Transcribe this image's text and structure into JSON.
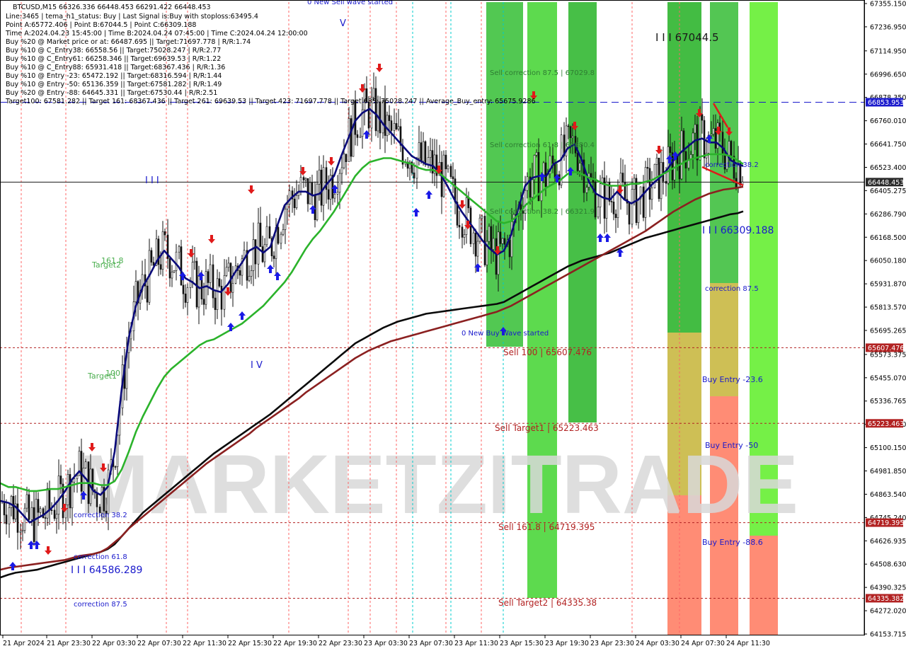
{
  "chart_data": {
    "type": "line",
    "symbol": "BTCUSD,M15",
    "header": "BTCUSD,M15  66326.336 66448.453 66291.422 66448.453",
    "info_lines": [
      "Line:3465 | tema_h1_status: Buy | Last Signal is:Buy with stoploss:63495.4",
      "Point A:65772.406 | Point B:67044.5 | Point C:66309.188",
      "Time A:2024.04.23 15:45:00 | Time B:2024.04.24 07:45:00 | Time C:2024.04.24 12:00:00",
      "Buy %20 @ Market price or at: 66487.695 || Target:71697.778 | R/R:1.74",
      "Buy %10 @ C_Entry38: 66558.56 || Target:75028.247 | R/R:2.77",
      "Buy %10 @ C_Entry61: 66258.346 || Target:69639.53 | R/R:1.22",
      "Buy %10 @ C_Entry88: 65931.418 || Target:68367.436 | R/R:1.36",
      "Buy %10 @ Entry -23: 65472.192 || Target:68316.594 | R/R:1.44",
      "Buy %10 @ Entry -50: 65136.359 || Target:67581.282 | R/R:1.49",
      "Buy %20 @ Entry -88: 64645.331 || Target:67530.44 | R/R:2.51",
      "Target100: 67581.282 || Target 161: 68367.436 || Target 261: 69639.53 || Target 423: 71697.778 || Target 685: 75028.247 || Average_Buy_entry: 65675.9286"
    ],
    "watermark": "MARKETZITRADE",
    "ylim": [
      64153.715,
      67355.15
    ],
    "y_ticks": [
      "67355.150",
      "67236.950",
      "67114.950",
      "66996.650",
      "66878.350",
      "66760.010",
      "66641.750",
      "66523.400",
      "66405.275",
      "66286.790",
      "66168.500",
      "66050.180",
      "65931.870",
      "65813.570",
      "65695.265",
      "65573.375",
      "65455.070",
      "65336.765",
      "65218.460",
      "65100.150",
      "64981.850",
      "64863.540",
      "64745.240",
      "64626.935",
      "64508.630",
      "64390.325",
      "64272.020",
      "64153.715"
    ],
    "x_ticks": [
      "21 Apr 2024",
      "21 Apr 23:30",
      "22 Apr 03:30",
      "22 Apr 07:30",
      "22 Apr 11:30",
      "22 Apr 15:30",
      "22 Apr 19:30",
      "22 Apr 23:30",
      "23 Apr 03:30",
      "23 Apr 07:30",
      "23 Apr 11:30",
      "23 Apr 15:30",
      "23 Apr 19:30",
      "23 Apr 23:30",
      "24 Apr 03:30",
      "24 Apr 07:30",
      "24 Apr 11:30"
    ],
    "price_markers": [
      {
        "value": 66853.953,
        "label": "66853.953",
        "color": "#1a1acc",
        "style": "dashed"
      },
      {
        "value": 66448.453,
        "label": "66448.453",
        "color": "#1a1a1a",
        "style": "solid"
      },
      {
        "value": 65607.476,
        "label": "65607.476",
        "color": "#b22222",
        "style": "dotted"
      },
      {
        "value": 65223.463,
        "label": "65223.463",
        "color": "#b22222",
        "style": "dotted"
      },
      {
        "value": 64719.395,
        "label": "64719.395",
        "color": "#b22222",
        "style": "dotted"
      },
      {
        "value": 64335.382,
        "label": "64335.382",
        "color": "#b22222",
        "style": "dotted"
      }
    ],
    "annotations": [
      {
        "text": "0 New Sell wave started",
        "color": "#1a1acc"
      },
      {
        "text": "Sell correction 87.5 | 67029.8",
        "color": "#2e7d32"
      },
      {
        "text": "Sell correction 61.8 | 66680.4",
        "color": "#2e7d32"
      },
      {
        "text": "Sell correction 38.2 | 66321.9",
        "color": "#2e7d32"
      },
      {
        "text": "0 New Buy Wave started",
        "color": "#1a1acc"
      },
      {
        "text": "Sell 100 | 65607.476",
        "color": "#b22222"
      },
      {
        "text": "Sell Target1 | 65223.463",
        "color": "#b22222"
      },
      {
        "text": "Sell 161.8 | 64719.395",
        "color": "#b22222"
      },
      {
        "text": "Sell Target2 | 64335.38",
        "color": "#b22222"
      },
      {
        "text": "I I I 67044.5",
        "color": "#1a1a1a"
      },
      {
        "text": "correction 38.2",
        "color": "#1a1acc"
      },
      {
        "text": "I I I 66309.188",
        "color": "#1a1acc"
      },
      {
        "text": "correction 87.5",
        "color": "#1a1acc"
      },
      {
        "text": "Buy Entry -23.6",
        "color": "#1a1acc"
      },
      {
        "text": "Buy Entry -50",
        "color": "#1a1acc"
      },
      {
        "text": "Buy Entry -88.6",
        "color": "#1a1acc"
      },
      {
        "text": "Target2",
        "color": "#4caf50"
      },
      {
        "text": "161.8",
        "color": "#4caf50"
      },
      {
        "text": "Target1",
        "color": "#4caf50"
      },
      {
        "text": "100",
        "color": "#4caf50"
      },
      {
        "text": "correction 38.2",
        "color": "#1a1acc"
      },
      {
        "text": "correction 61.8",
        "color": "#1a1acc"
      },
      {
        "text": "I I I 64586.289",
        "color": "#1a1acc"
      },
      {
        "text": "correction 87.5",
        "color": "#1a1acc"
      },
      {
        "text": "I I I",
        "color": "#1a1acc"
      },
      {
        "text": "I V",
        "color": "#1a1acc"
      },
      {
        "text": "V",
        "color": "#1a1acc"
      }
    ],
    "series": [
      {
        "name": "",
        "color": "#0a0a7a",
        "x": [
          0,
          12,
          22,
          32,
          42,
          52,
          62,
          72,
          82,
          92,
          102,
          112,
          122,
          132,
          142,
          152,
          162,
          172,
          182,
          192,
          202,
          212,
          222,
          232,
          242,
          252,
          262,
          272,
          282,
          292,
          302,
          312,
          322,
          332,
          342,
          352,
          362,
          372,
          382,
          392,
          402,
          412,
          422,
          432,
          442,
          452,
          462,
          472,
          482,
          492,
          502,
          512,
          522,
          532,
          542,
          552,
          562,
          572,
          582,
          592,
          602,
          612,
          622,
          632,
          642,
          652,
          662,
          672,
          682,
          692,
          702,
          712,
          722,
          732,
          742,
          752,
          762,
          772,
          782,
          792,
          802,
          812,
          822,
          832,
          842,
          852,
          862,
          872,
          882,
          892,
          902,
          912,
          922,
          932,
          942,
          952,
          962,
          972,
          982,
          992,
          1002,
          1012,
          1022,
          1032,
          1042,
          1050
        ],
        "values": [
          64830,
          64820,
          64800,
          64760,
          64720,
          64740,
          64760,
          64790,
          64830,
          64880,
          64940,
          64980,
          64940,
          64880,
          64860,
          64900,
          65080,
          65400,
          65660,
          65820,
          65920,
          65980,
          66050,
          66100,
          66060,
          66020,
          65960,
          65940,
          65910,
          65920,
          65900,
          65890,
          65930,
          65990,
          66040,
          66100,
          66120,
          66090,
          66120,
          66230,
          66330,
          66370,
          66400,
          66400,
          66380,
          66390,
          66440,
          66480,
          66580,
          66670,
          66760,
          66800,
          66820,
          66790,
          66740,
          66700,
          66660,
          66620,
          66580,
          66560,
          66540,
          66530,
          66490,
          66430,
          66360,
          66300,
          66250,
          66200,
          66150,
          66110,
          66080,
          66100,
          66180,
          66310,
          66430,
          66470,
          66480,
          66480,
          66540,
          66560,
          66620,
          66640,
          66560,
          66450,
          66390,
          66370,
          66360,
          66400,
          66360,
          66340,
          66360,
          66400,
          66440,
          66470,
          66510,
          66560,
          66600,
          66630,
          66660,
          66670,
          66650,
          66650,
          66620,
          66560,
          66540,
          66530
        ]
      },
      {
        "name": "",
        "color": "#2bb32b",
        "x": [
          0,
          12,
          22,
          32,
          42,
          52,
          62,
          72,
          82,
          92,
          102,
          112,
          122,
          132,
          142,
          152,
          162,
          172,
          182,
          192,
          202,
          212,
          222,
          232,
          242,
          252,
          262,
          272,
          282,
          292,
          302,
          312,
          322,
          332,
          342,
          352,
          362,
          372,
          382,
          392,
          402,
          412,
          422,
          432,
          442,
          452,
          462,
          472,
          482,
          492,
          502,
          512,
          522,
          532,
          542,
          552,
          562,
          572,
          582,
          592,
          602,
          612,
          622,
          632,
          642,
          652,
          662,
          672,
          682,
          692,
          702,
          712,
          722,
          732,
          742,
          752,
          762,
          772,
          782,
          792,
          802,
          812,
          822,
          832,
          842,
          852,
          862,
          872,
          882,
          892,
          902,
          912,
          922,
          932,
          942,
          952,
          962,
          972,
          982,
          992,
          1002,
          1012,
          1022,
          1032,
          1042,
          1050
        ],
        "values": [
          64920,
          64900,
          64900,
          64890,
          64880,
          64880,
          64885,
          64890,
          64890,
          64900,
          64910,
          64920,
          64920,
          64920,
          64910,
          64910,
          64930,
          64990,
          65080,
          65180,
          65260,
          65330,
          65400,
          65460,
          65500,
          65530,
          65560,
          65590,
          65620,
          65640,
          65650,
          65670,
          65690,
          65710,
          65730,
          65760,
          65790,
          65820,
          65860,
          65900,
          65940,
          65990,
          66050,
          66110,
          66160,
          66200,
          66250,
          66300,
          66360,
          66420,
          66480,
          66520,
          66550,
          66560,
          66570,
          66570,
          66560,
          66550,
          66540,
          66520,
          66510,
          66510,
          66490,
          66460,
          66430,
          66400,
          66370,
          66340,
          66310,
          66280,
          66250,
          66240,
          66250,
          66280,
          66330,
          66360,
          66390,
          66420,
          66440,
          66460,
          66490,
          66500,
          66490,
          66470,
          66460,
          66440,
          66430,
          66430,
          66430,
          66440,
          66440,
          66450,
          66460,
          66480,
          66500,
          66520,
          66540,
          66560,
          66570,
          66580,
          66590,
          66590,
          66590,
          66580,
          66560,
          66540
        ]
      },
      {
        "name": "",
        "color": "#0a0a0a",
        "x": [
          0,
          12,
          22,
          32,
          42,
          52,
          62,
          72,
          82,
          92,
          102,
          112,
          122,
          132,
          142,
          152,
          162,
          172,
          182,
          192,
          202,
          212,
          222,
          232,
          242,
          252,
          262,
          272,
          282,
          292,
          302,
          312,
          322,
          332,
          342,
          352,
          362,
          372,
          382,
          392,
          402,
          412,
          422,
          432,
          442,
          452,
          462,
          472,
          482,
          492,
          502,
          512,
          522,
          532,
          542,
          552,
          562,
          572,
          582,
          592,
          602,
          612,
          622,
          632,
          642,
          652,
          662,
          672,
          682,
          692,
          702,
          712,
          722,
          732,
          742,
          752,
          762,
          772,
          782,
          792,
          802,
          812,
          822,
          832,
          842,
          852,
          862,
          872,
          882,
          892,
          902,
          912,
          922,
          932,
          942,
          952,
          962,
          972,
          982,
          992,
          1002,
          1012,
          1022,
          1032,
          1042,
          1050
        ],
        "values": [
          64440,
          64455,
          64465,
          64470,
          64475,
          64480,
          64490,
          64500,
          64510,
          64520,
          64530,
          64540,
          64550,
          64560,
          64570,
          64585,
          64610,
          64650,
          64690,
          64730,
          64770,
          64800,
          64830,
          64860,
          64890,
          64920,
          64950,
          64980,
          65010,
          65040,
          65070,
          65095,
          65120,
          65145,
          65170,
          65195,
          65220,
          65245,
          65270,
          65300,
          65330,
          65360,
          65390,
          65420,
          65450,
          65480,
          65510,
          65540,
          65570,
          65600,
          65630,
          65650,
          65670,
          65690,
          65710,
          65725,
          65740,
          65750,
          65760,
          65770,
          65780,
          65785,
          65790,
          65795,
          65800,
          65805,
          65810,
          65815,
          65820,
          65825,
          65830,
          65840,
          65860,
          65880,
          65900,
          65920,
          65940,
          65960,
          65980,
          66000,
          66020,
          66035,
          66050,
          66060,
          66070,
          66080,
          66090,
          66105,
          66120,
          66135,
          66150,
          66165,
          66175,
          66185,
          66195,
          66205,
          66215,
          66225,
          66235,
          66245,
          66255,
          66265,
          66275,
          66285,
          66290,
          66300
        ]
      },
      {
        "name": "",
        "color": "#8b2020",
        "x": [
          0,
          12,
          22,
          32,
          42,
          52,
          62,
          72,
          82,
          92,
          102,
          112,
          122,
          132,
          142,
          152,
          162,
          172,
          182,
          192,
          202,
          212,
          222,
          232,
          242,
          252,
          262,
          272,
          282,
          292,
          302,
          312,
          322,
          332,
          342,
          352,
          362,
          372,
          382,
          392,
          402,
          412,
          422,
          432,
          442,
          452,
          462,
          472,
          482,
          492,
          502,
          512,
          522,
          532,
          542,
          552,
          562,
          572,
          582,
          592,
          602,
          612,
          622,
          632,
          642,
          652,
          662,
          672,
          682,
          692,
          702,
          712,
          722,
          732,
          742,
          752,
          762,
          772,
          782,
          792,
          802,
          812,
          822,
          832,
          842,
          852,
          862,
          872,
          882,
          892,
          902,
          912,
          922,
          932,
          942,
          952,
          962,
          972,
          982,
          992,
          1002,
          1012,
          1022,
          1032,
          1042,
          1050
        ],
        "values": [
          64480,
          64490,
          64495,
          64500,
          64505,
          64510,
          64515,
          64520,
          64525,
          64530,
          64540,
          64550,
          64555,
          64560,
          64570,
          64590,
          64620,
          64650,
          64690,
          64720,
          64750,
          64780,
          64810,
          64840,
          64870,
          64900,
          64930,
          64960,
          64990,
          65020,
          65045,
          65070,
          65095,
          65120,
          65145,
          65170,
          65200,
          65225,
          65250,
          65275,
          65300,
          65325,
          65350,
          65380,
          65405,
          65430,
          65455,
          65480,
          65505,
          65530,
          65555,
          65575,
          65595,
          65610,
          65625,
          65640,
          65650,
          65660,
          65670,
          65680,
          65690,
          65700,
          65710,
          65720,
          65730,
          65740,
          65750,
          65760,
          65770,
          65780,
          65790,
          65805,
          65820,
          65840,
          65860,
          65880,
          65900,
          65920,
          65940,
          65960,
          65980,
          66000,
          66020,
          66040,
          66060,
          66080,
          66100,
          66120,
          66140,
          66160,
          66180,
          66200,
          66225,
          66250,
          66275,
          66300,
          66320,
          66340,
          66360,
          66375,
          66390,
          66400,
          66410,
          66415,
          66420,
          66425
        ]
      }
    ]
  }
}
